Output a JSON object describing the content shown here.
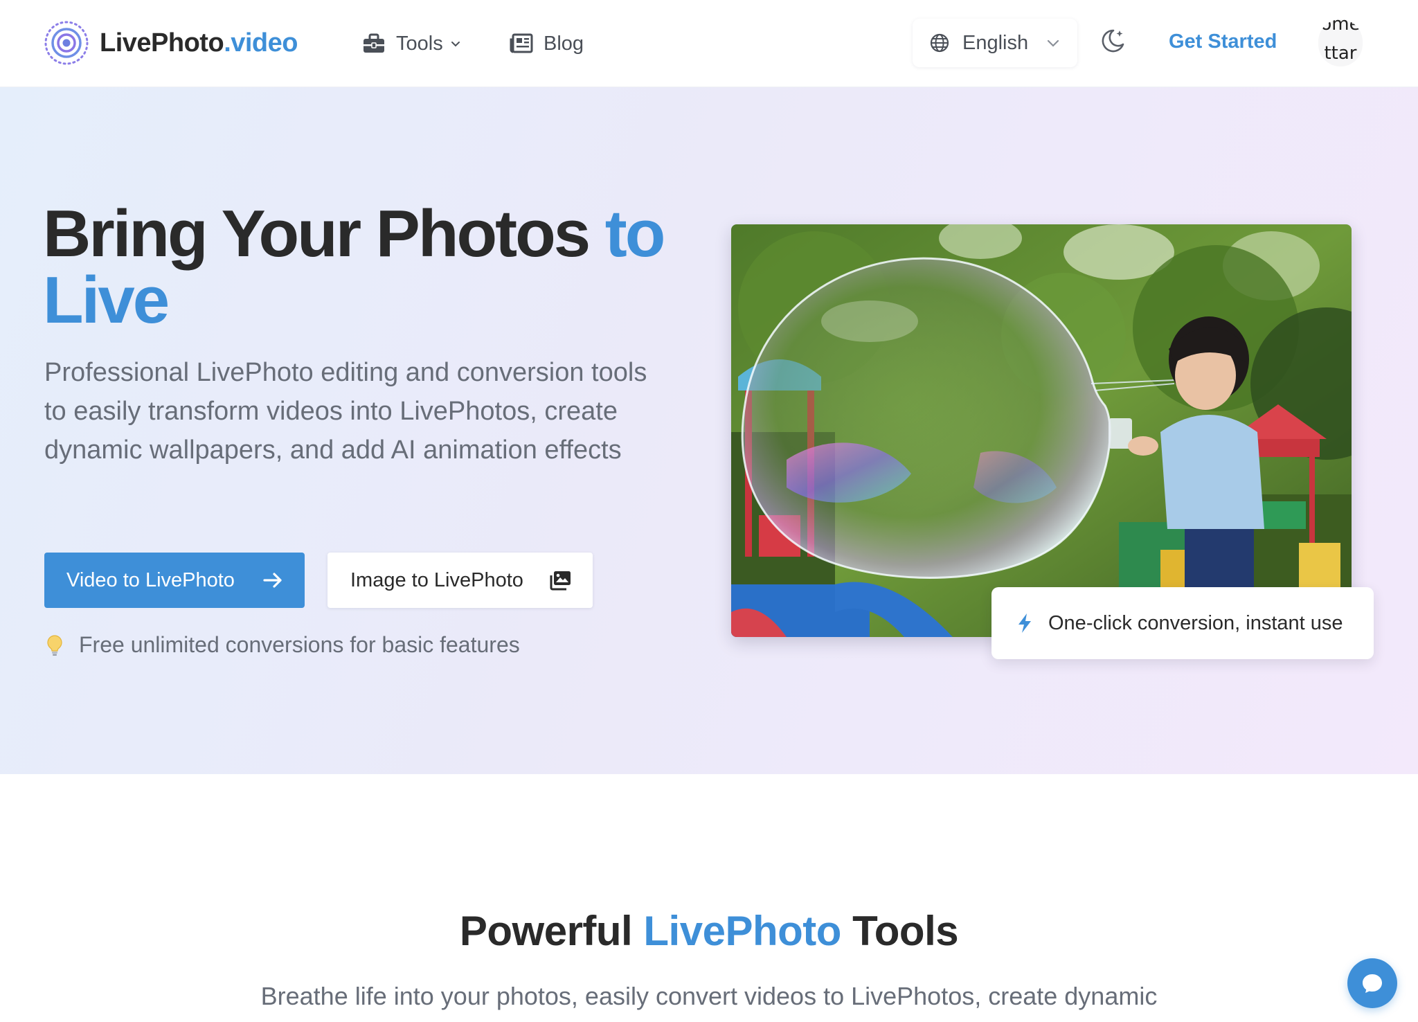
{
  "brand": {
    "name_part1": "LivePhoto",
    "name_part2": ".video"
  },
  "nav": {
    "tools_label": "Tools",
    "blog_label": "Blog",
    "language": "English",
    "get_started": "Get Started",
    "avatar_text_top": "ome",
    "avatar_text_bottom": "ttar"
  },
  "hero": {
    "title_main": "Bring Your Photos ",
    "title_accent_1": "to",
    "title_accent_2": "Live",
    "subtitle": "Professional LivePhoto editing and conversion tools to easily transform videos into LivePhotos, create dynamic wallpapers, and add AI animation effects",
    "primary_button": "Video to LivePhoto",
    "secondary_button": "Image to LivePhoto",
    "free_note": "Free unlimited conversions for basic features",
    "badge_text": "One-click conversion, instant use"
  },
  "tools_section": {
    "title_part1": "Powerful ",
    "title_accent": "LivePhoto",
    "title_part2": " Tools",
    "subtitle": "Breathe life into your photos, easily convert videos to LivePhotos, create dynamic"
  },
  "icons": {
    "logo": "logo-icon",
    "tools": "toolbox-icon",
    "blog": "newspaper-icon",
    "language": "globe-icon",
    "theme": "moon-icon",
    "arrow": "arrow-right-icon",
    "images": "images-icon",
    "bulb": "lightbulb-icon",
    "bolt": "bolt-icon",
    "chat": "chat-icon"
  },
  "colors": {
    "accent": "#3e8fd8",
    "text": "#2a2a2a",
    "muted": "#676d78"
  }
}
